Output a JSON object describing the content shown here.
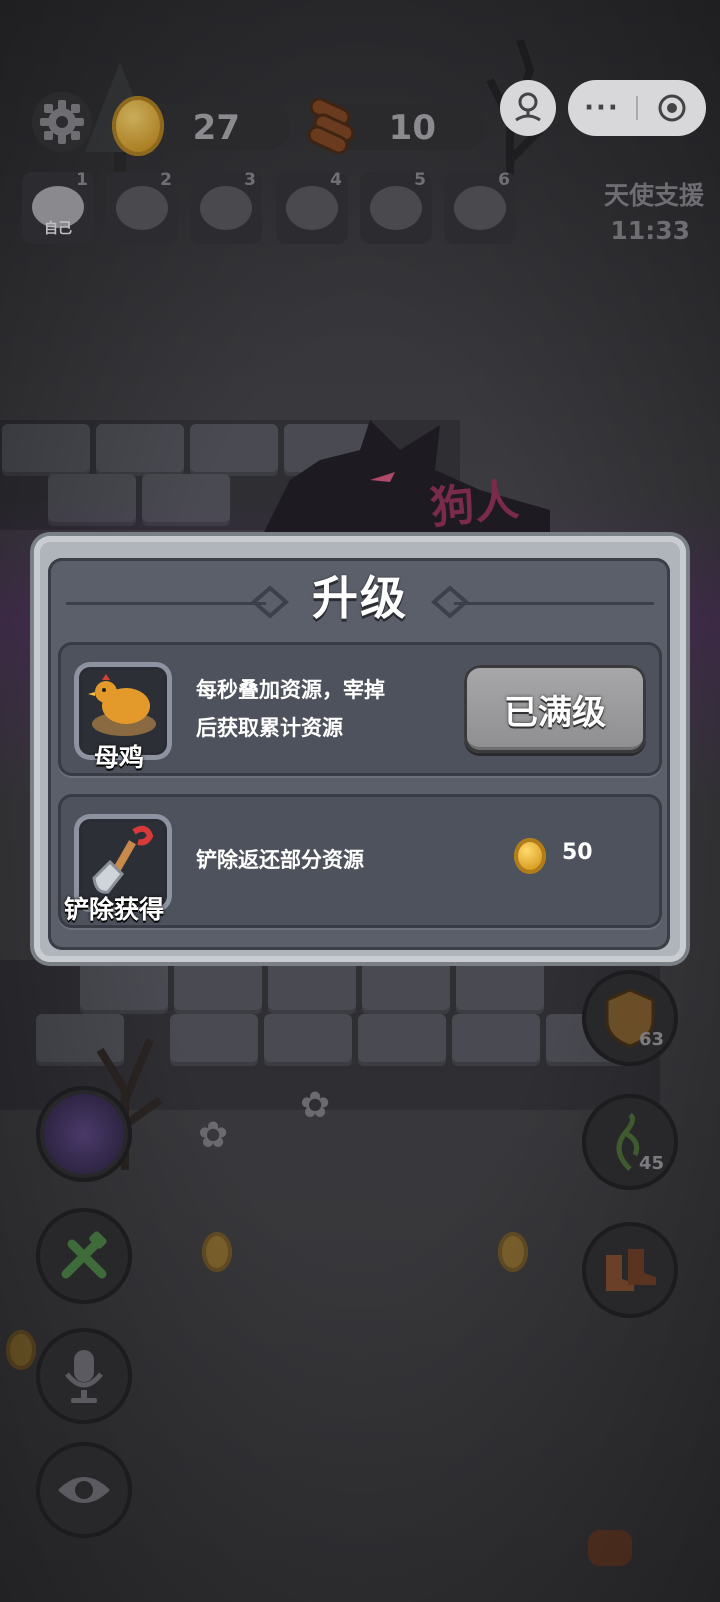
{
  "hud": {
    "coins": "27",
    "wood": "10",
    "player_slots": [
      {
        "num": "1",
        "tag": "自己"
      },
      {
        "num": "2",
        "tag": ""
      },
      {
        "num": "3",
        "tag": ""
      },
      {
        "num": "4",
        "tag": ""
      },
      {
        "num": "5",
        "tag": ""
      },
      {
        "num": "6",
        "tag": ""
      }
    ],
    "angel_support_label": "天使支援",
    "angel_support_timer": "11:33"
  },
  "scene": {
    "wolf_banner_text": "狗人"
  },
  "modal": {
    "title": "升级",
    "upgrade_row": {
      "item_name": "母鸡",
      "description_line1": "每秒叠加资源，宰掉",
      "description_line2": "后获取累计资源",
      "button_label": "已满级"
    },
    "remove_row": {
      "item_name": "铲除获得",
      "description": "铲除返还部分资源",
      "refund_amount": "50"
    }
  },
  "side_buttons": {
    "shield_count": "63",
    "thorn_count": "45"
  },
  "colors": {
    "modal_frame": "#b0b5bb",
    "modal_body": "#5b5f69",
    "coin": "#e0a52a",
    "button_gray": "#9b9b9e"
  }
}
